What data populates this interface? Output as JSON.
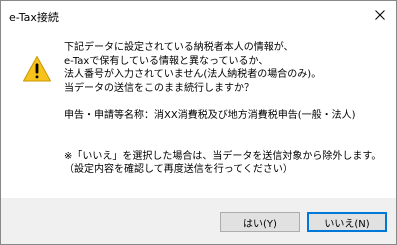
{
  "window": {
    "title": "e-Tax接続"
  },
  "message": {
    "lines": [
      "下記データに設定されている納税者本人の情報が、",
      "e-Taxで保有している情報と異なっているか、",
      "法人番号が入力されていません(法人納税者の場合のみ)。",
      "当データの送信をこのまま続行しますか？"
    ],
    "form_line": "申告・申請等名称：消XX消費税及び地方消費税申告(一般・法人)",
    "note_lines": [
      "※「いいえ」を選択した場合は、当データを送信対象から除外します。",
      "（設定内容を確認して再度送信を行ってください）"
    ]
  },
  "buttons": {
    "yes_label": "はい(Y)",
    "no_label": "いいえ(N)"
  },
  "icons": {
    "warning": "warning-icon",
    "close": "close-icon"
  },
  "colors": {
    "warning_fill": "#f7c21b",
    "focus_border": "#0078d7",
    "footer_bg": "#f0f0f0"
  }
}
